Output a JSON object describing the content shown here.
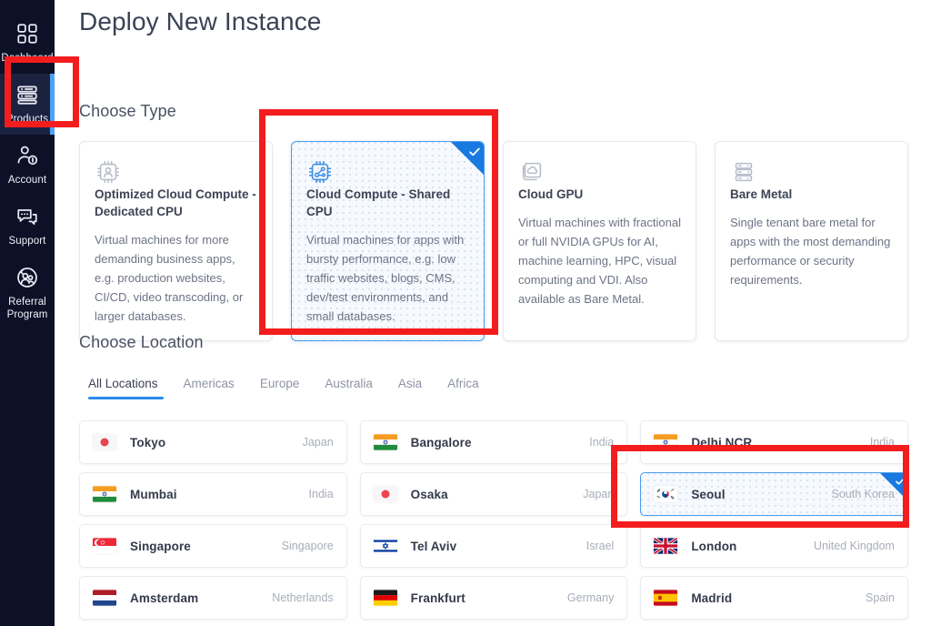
{
  "sidebar": {
    "items": [
      {
        "label": "Dashboard",
        "icon": "grid-dashboard-icon",
        "active": false
      },
      {
        "label": "Products",
        "icon": "server-stack-icon",
        "active": true
      },
      {
        "label": "Account",
        "icon": "user-account-icon",
        "active": false
      },
      {
        "label": "Support",
        "icon": "chat-support-icon",
        "active": false
      },
      {
        "label": "Referral\nProgram",
        "icon": "referral-users-icon",
        "active": false
      }
    ]
  },
  "page": {
    "title": "Deploy New Instance",
    "choose_type_heading": "Choose Type",
    "choose_location_heading": "Choose Location"
  },
  "type_cards": [
    {
      "icon": "cpu-person-icon",
      "title": "Optimized Cloud Compute - Dedicated CPU",
      "description": "Virtual machines for more demanding business apps, e.g. production websites, CI/CD, video transcoding, or larger databases.",
      "selected": false
    },
    {
      "icon": "cpu-shared-icon",
      "title": "Cloud Compute - Shared CPU",
      "description": "Virtual machines for apps with bursty performance, e.g. low traffic websites, blogs, CMS, dev/test environments, and small databases.",
      "selected": true
    },
    {
      "icon": "gpu-cloud-icon",
      "title": "Cloud GPU",
      "description": "Virtual machines with fractional or full NVIDIA GPUs for AI, machine learning, HPC, visual computing and VDI. Also available as Bare Metal.",
      "selected": false
    },
    {
      "icon": "bare-metal-server-icon",
      "title": "Bare Metal",
      "description": "Single tenant bare metal for apps with the most demanding performance or security requirements.",
      "selected": false
    }
  ],
  "location_tabs": [
    {
      "label": "All Locations",
      "active": true
    },
    {
      "label": "Americas",
      "active": false
    },
    {
      "label": "Europe",
      "active": false
    },
    {
      "label": "Australia",
      "active": false
    },
    {
      "label": "Asia",
      "active": false
    },
    {
      "label": "Africa",
      "active": false
    }
  ],
  "locations": [
    {
      "city": "Tokyo",
      "country": "Japan",
      "flag": "jp",
      "selected": false
    },
    {
      "city": "Bangalore",
      "country": "India",
      "flag": "in",
      "selected": false
    },
    {
      "city": "Delhi NCR",
      "country": "India",
      "flag": "in",
      "selected": false
    },
    {
      "city": "Mumbai",
      "country": "India",
      "flag": "in",
      "selected": false
    },
    {
      "city": "Osaka",
      "country": "Japan",
      "flag": "jp",
      "selected": false
    },
    {
      "city": "Seoul",
      "country": "South Korea",
      "flag": "kr",
      "selected": true
    },
    {
      "city": "Singapore",
      "country": "Singapore",
      "flag": "sg",
      "selected": false
    },
    {
      "city": "Tel Aviv",
      "country": "Israel",
      "flag": "il",
      "selected": false
    },
    {
      "city": "London",
      "country": "United Kingdom",
      "flag": "gb",
      "selected": false
    },
    {
      "city": "Amsterdam",
      "country": "Netherlands",
      "flag": "nl",
      "selected": false
    },
    {
      "city": "Frankfurt",
      "country": "Germany",
      "flag": "de",
      "selected": false
    },
    {
      "city": "Madrid",
      "country": "Spain",
      "flag": "es",
      "selected": false
    }
  ],
  "colors": {
    "sidebar_bg": "#0d1127",
    "sidebar_active_bg": "#1b2240",
    "accent_blue": "#2b8cf0",
    "selected_border": "#4a9cf0",
    "check_badge": "#1879e0",
    "highlight_red": "#f41d1d"
  },
  "annotations": [
    {
      "name": "products-nav-highlight"
    },
    {
      "name": "shared-cpu-card-highlight"
    },
    {
      "name": "seoul-location-highlight"
    }
  ]
}
